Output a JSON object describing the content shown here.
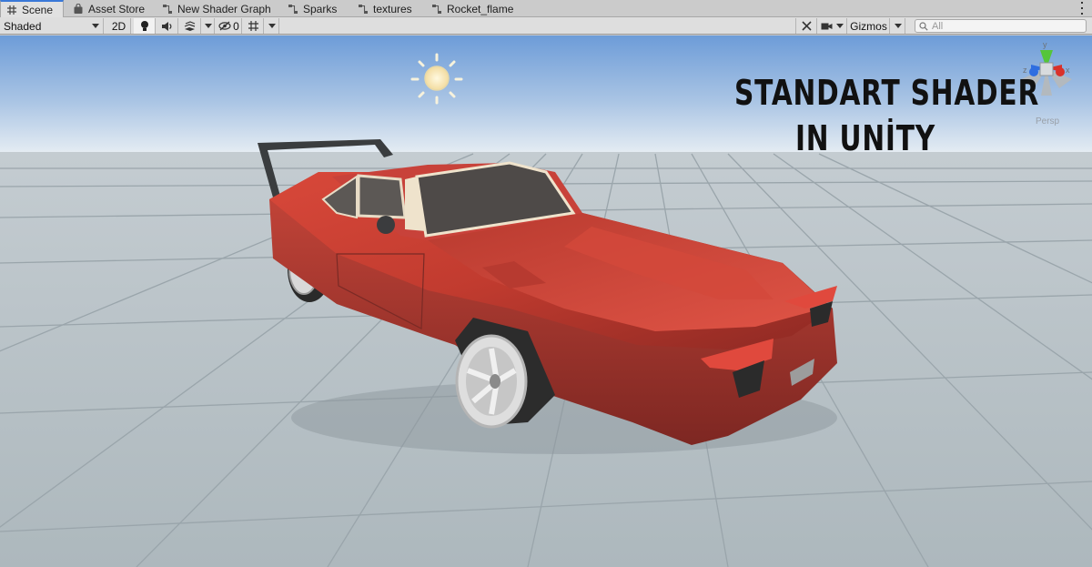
{
  "tabs": [
    {
      "label": "Scene",
      "icon": "scene-grid-icon",
      "active": true
    },
    {
      "label": "Asset Store",
      "icon": "store-bag-icon",
      "active": false
    },
    {
      "label": "New Shader Graph",
      "icon": "shader-graph-icon",
      "active": false
    },
    {
      "label": "Sparks",
      "icon": "shader-graph-icon",
      "active": false
    },
    {
      "label": "textures",
      "icon": "shader-graph-icon",
      "active": false
    },
    {
      "label": "Rocket_flame",
      "icon": "shader-graph-icon",
      "active": false
    }
  ],
  "toolbar": {
    "draw_mode": "Shaded",
    "mode_2d": "2D",
    "hidden_count": "0",
    "gizmos": "Gizmos",
    "search_placeholder": "All"
  },
  "scene": {
    "overlay_line1": "STANDART SHADER",
    "overlay_line2": "IN UNİTY",
    "projection": "Persp",
    "axis_y": "y",
    "axis_x": "x",
    "axis_z": "z"
  },
  "colors": {
    "sky_top": "#6f9fd9",
    "horizon": "#dbe5ee",
    "ground": "#b3bdc2",
    "grid_line": "#9ea9ae",
    "car_body": "#c7382c",
    "accent": "#3a79d8"
  }
}
